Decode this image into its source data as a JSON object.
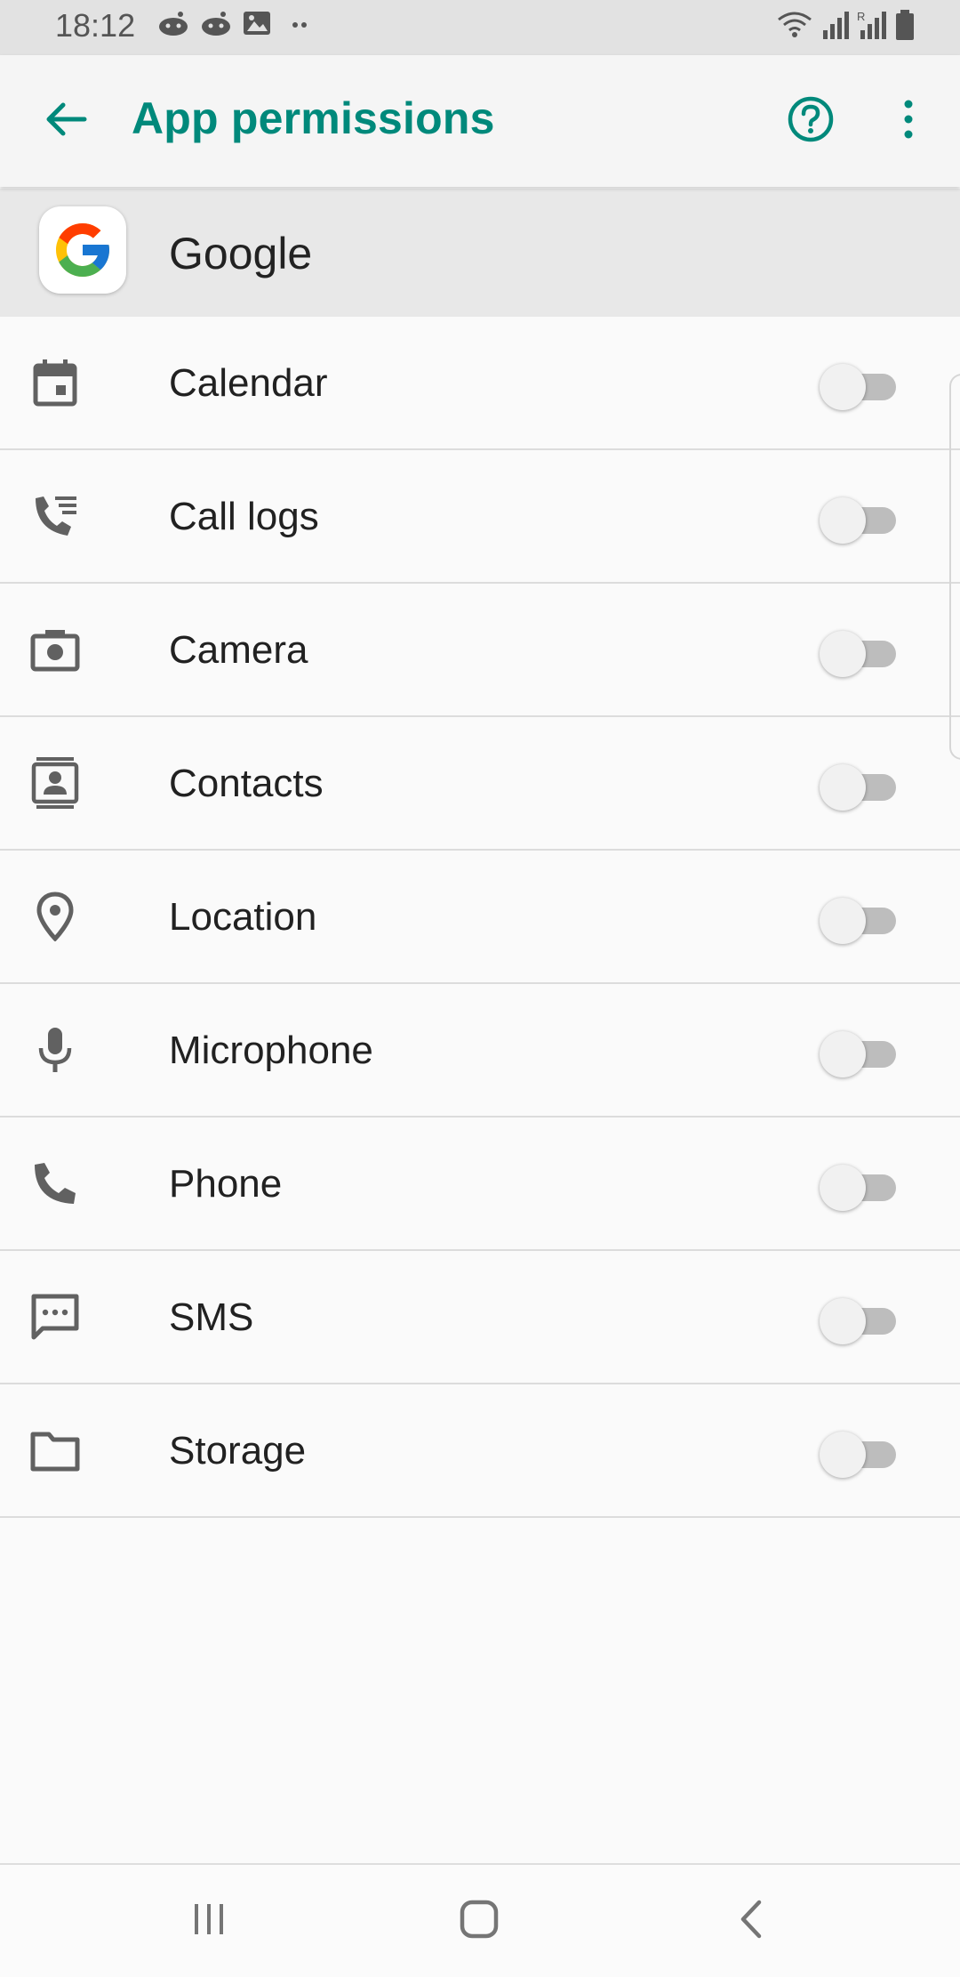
{
  "status_bar": {
    "time": "18:12",
    "left_icons": [
      "reddit-icon",
      "reddit-icon",
      "image-icon",
      "more-dots-icon"
    ],
    "right_icons": [
      "wifi-icon",
      "signal-icon",
      "signal-roaming-icon",
      "battery-icon"
    ]
  },
  "app_bar": {
    "title": "App permissions",
    "back_icon": "arrow-back-icon",
    "help_icon": "help-circle-icon",
    "more_icon": "more-vert-icon",
    "accent_color": "#00897b"
  },
  "app": {
    "name": "Google",
    "logo_icon": "google-g-logo"
  },
  "permissions": [
    {
      "label": "Calendar",
      "icon": "calendar-icon",
      "enabled": false
    },
    {
      "label": "Call logs",
      "icon": "call-log-icon",
      "enabled": false
    },
    {
      "label": "Camera",
      "icon": "camera-icon",
      "enabled": false
    },
    {
      "label": "Contacts",
      "icon": "contacts-icon",
      "enabled": false
    },
    {
      "label": "Location",
      "icon": "location-pin-icon",
      "enabled": false
    },
    {
      "label": "Microphone",
      "icon": "microphone-icon",
      "enabled": false
    },
    {
      "label": "Phone",
      "icon": "phone-icon",
      "enabled": false
    },
    {
      "label": "SMS",
      "icon": "sms-icon",
      "enabled": false
    },
    {
      "label": "Storage",
      "icon": "folder-icon",
      "enabled": false
    }
  ],
  "nav_bar": {
    "recents_icon": "recents-icon",
    "home_icon": "home-icon",
    "back_icon": "back-chevron-icon"
  }
}
